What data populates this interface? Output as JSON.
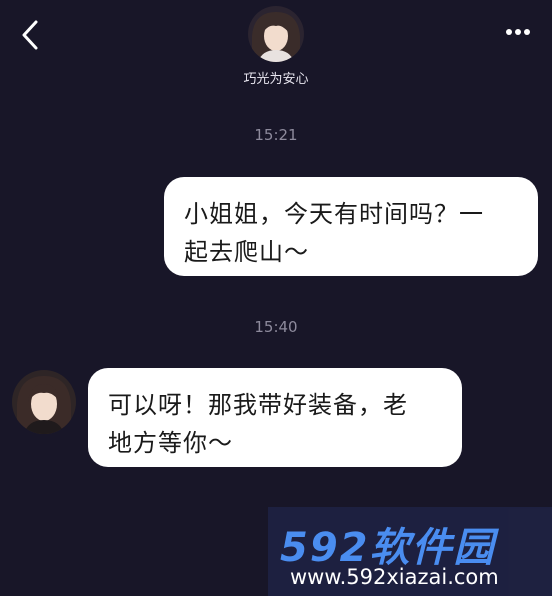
{
  "header": {
    "contact_name": "巧光为安心",
    "back_icon": "chevron-left-icon",
    "more_icon": "more-dots-icon"
  },
  "messages": [
    {
      "time": "15:21",
      "direction": "outgoing",
      "line1": "小姐姐，今天有时间吗？一",
      "line2": "起去爬山～"
    },
    {
      "time": "15:40",
      "direction": "incoming",
      "line1": "可以呀！那我带好装备，老",
      "line2": "地方等你～"
    }
  ],
  "watermark": {
    "title": "592软件园",
    "url": "www.592xiazai.com"
  },
  "colors": {
    "background": "#181628",
    "bubble": "#ffffff",
    "timestamp": "#8d8a9c",
    "watermark_blue": "#4a8df0"
  }
}
